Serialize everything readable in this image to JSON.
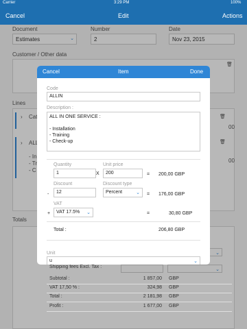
{
  "status": {
    "carrier": "Carrier",
    "time": "3:29 PM",
    "battery": "100%"
  },
  "nav": {
    "cancel": "Cancel",
    "title": "Edit",
    "actions": "Actions"
  },
  "document": {
    "document_label": "Document",
    "document_value": "Estimates",
    "number_label": "Number",
    "number_value": "2",
    "date_label": "Date",
    "date_value": "Nov 23, 2015",
    "customer_label": "Customer / Other data",
    "lines_label": "Lines",
    "line1_text": "Cat",
    "line1_amount": "00",
    "line2_text": "ALL",
    "line2_sub1": "- In",
    "line2_sub2": "- Tr",
    "line2_sub3": "- C",
    "line2_amount": "00",
    "totals_label": "Totals",
    "shipping_label": "Shipping fees Excl. Tax :"
  },
  "totals": [
    {
      "label": "Subtotal :",
      "value": "1 857,00",
      "currency": "GBP"
    },
    {
      "label": "VAT 17,50 % :",
      "value": "324,98",
      "currency": "GBP"
    },
    {
      "label": "Total :",
      "value": "2 181,98",
      "currency": "GBP"
    },
    {
      "label": "Profit :",
      "value": "1 677,00",
      "currency": "GBP"
    }
  ],
  "modal": {
    "cancel": "Cancel",
    "title": "Item",
    "done": "Done",
    "code_label": "Code",
    "code_value": "ALLIN",
    "description_label": "Description :",
    "description_lines": [
      "ALL IN ONE SERVICE :",
      "",
      "- Installation",
      "- Training",
      "- Check-up"
    ],
    "quantity_label": "Quantity",
    "quantity_value": "1",
    "times": "X",
    "unit_price_label": "Unit price",
    "unit_price_value": "200",
    "equals1": "=",
    "line_amount": "200,00 GBP",
    "discount_label": "Discount",
    "discount_minus": "-",
    "discount_value": "12",
    "discount_type_label": "Discount type",
    "discount_type_value": "Percent",
    "equals2": "=",
    "discount_amount": "176,00 GBP",
    "vat_label": "VAT",
    "vat_plus": "+",
    "vat_value": "VAT 17.5%",
    "equals3": "=",
    "vat_amount": "30,80 GBP",
    "total_label": "Total :",
    "total_value": "206,80 GBP",
    "unit_label": "Unit",
    "unit_value": "u"
  }
}
